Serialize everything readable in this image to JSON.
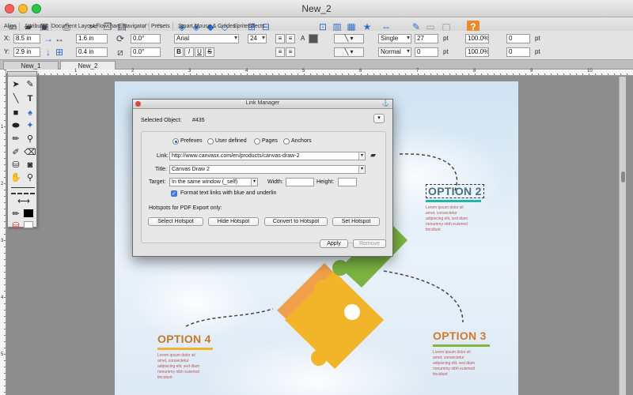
{
  "window": {
    "title": "New_2"
  },
  "palette_tabs": [
    "Align",
    "Attributes",
    "Document Layout",
    "Flowchart",
    "Navigator",
    "Presets",
    "Smart Mouse & Guides",
    "SpriteEffects"
  ],
  "properties": {
    "x_label": "X:",
    "x_value": "8.5 in",
    "y_label": "Y:",
    "y_value": "2.9 in",
    "width_value": "1.6 in",
    "height_value": "0.4 in",
    "rotation_1": "0.0°",
    "rotation_2": "0.0°",
    "font": "Arial",
    "font_size": "24",
    "text_style_bold": "B",
    "text_style_italic": "I",
    "text_style_underline": "U",
    "text_style_strike": "S",
    "line_spacing": "Single",
    "line_spacing_value": "27",
    "line_spacing_unit": "pt",
    "scale_1": "100.0%",
    "spacing_value_1": "0",
    "spacing_unit_1": "pt",
    "baseline": "Normal",
    "baseline_value": "0",
    "baseline_unit": "pt",
    "scale_2": "100.0%",
    "spacing_value_2": "0",
    "spacing_unit_2": "pt"
  },
  "doc_tabs": [
    "New_1",
    "New_2"
  ],
  "ruler": {
    "marks": [
      "1",
      "2",
      "3",
      "4",
      "5",
      "6",
      "7",
      "8",
      "9",
      "10",
      "11"
    ],
    "vmarks": [
      "1",
      "2",
      "3",
      "4",
      "5"
    ]
  },
  "canvas": {
    "option2": {
      "title": "OPTION 2",
      "accent": "#1fb8a8"
    },
    "option3": {
      "title": "OPTION 3",
      "accent": "#7fb83d"
    },
    "option4": {
      "title": "OPTION 4",
      "accent": "#f2b428"
    },
    "lorem": "Lorem ipsum dolor sit amet, consectetur adipiscing elit, sed diam nonummy nibh euismod tincidunt"
  },
  "dialog": {
    "title": "Link Manager",
    "selected_label": "Selected Object:",
    "selected_value": "#435",
    "radio_options": [
      "Prefexes",
      "User defined",
      "Pages",
      "Anchors"
    ],
    "link_label": "Link:",
    "link_value": "http://www.canvasx.com/en/products/canvas-draw-2",
    "title_label": "Title:",
    "title_value": "Canvas Draw 2",
    "target_label": "Target:",
    "target_value": "In the same window (_self)",
    "width_label": "Width:",
    "height_label": "Height:",
    "format_checkbox": "Format text links with blue and underlin",
    "hotspots_label": "Hotspots for PDF Export only:",
    "buttons": [
      "Select Hotspot",
      "Hide Hotspot",
      "Convert to Hotspot",
      "Set Hotspot"
    ],
    "apply": "Apply",
    "remove": "Remove"
  }
}
